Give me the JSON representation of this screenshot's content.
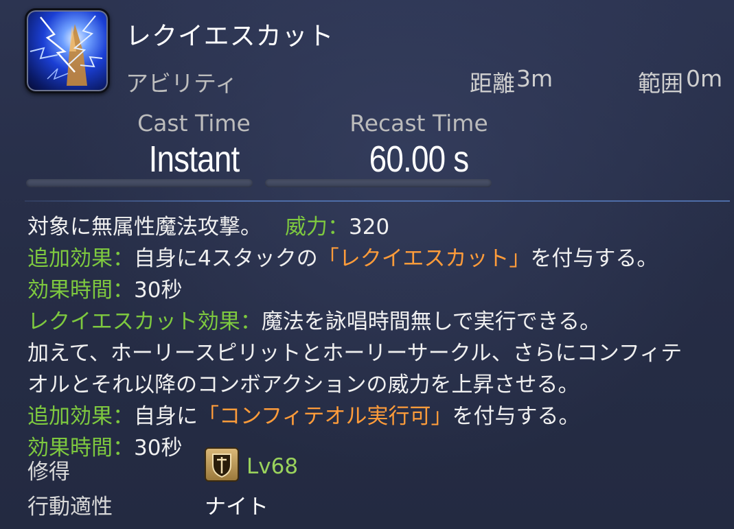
{
  "skill": {
    "name": "レクイエスカット",
    "category": "アビリティ",
    "range_label": "距離",
    "range_value": "3m",
    "radius_label": "範囲",
    "radius_value": "0m"
  },
  "stats": {
    "cast_label": "Cast Time",
    "cast_value": "Instant",
    "recast_label": "Recast Time",
    "recast_value": "60.00 s"
  },
  "description": {
    "line1_text": "対象に無属性魔法攻撃。",
    "potency_label": "威力：",
    "potency_value": "320",
    "line2_label": "追加効果：",
    "line2_text_a": "自身に4スタックの",
    "line2_highlight": "「レクイエスカット」",
    "line2_text_b": "を付与する。",
    "line3_label": "効果時間：",
    "line3_value": "30秒",
    "line4_label": "レクイエスカット効果：",
    "line4_text": "魔法を詠唱時間無しで実行できる。",
    "line5_text": "加えて、ホーリースピリットとホーリーサークル、さらにコンフィテ",
    "line6_text": "オルとそれ以降のコンボアクションの威力を上昇させる。",
    "line7_label": "追加効果：",
    "line7_text_a": "自身に",
    "line7_highlight": "「コンフィテオル実行可」",
    "line7_text_b": "を付与する。",
    "line8_label": "効果時間：",
    "line8_value": "30秒"
  },
  "footer": {
    "acquire_label": "修得",
    "level": "Lv68",
    "class_label": "行動適性",
    "job": "ナイト"
  },
  "icons": {
    "skill_icon": "lightning-sword-icon",
    "job_icon": "paladin-shield-icon"
  },
  "colors": {
    "background": "#262d45",
    "green_label": "#7ec93f",
    "orange_highlight": "#ff9c3a",
    "level_text": "#9ad25c"
  }
}
